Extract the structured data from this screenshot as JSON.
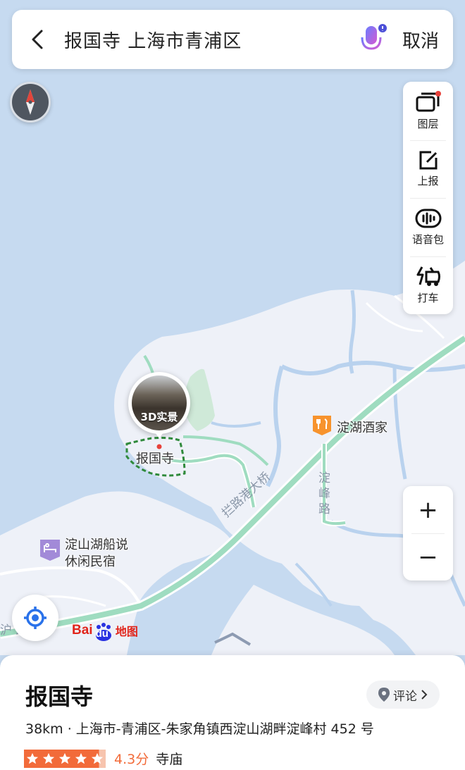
{
  "search": {
    "query": "报国寺 上海市青浦区",
    "cancel_label": "取消"
  },
  "tools": [
    {
      "label": "图层",
      "icon": "layers-icon"
    },
    {
      "label": "上报",
      "icon": "report-icon"
    },
    {
      "label": "语音包",
      "icon": "voice-pack-icon"
    },
    {
      "label": "打车",
      "icon": "taxi-icon"
    }
  ],
  "zoom": {
    "in_label": "+",
    "out_label": "−"
  },
  "map": {
    "pano_label": "3D实景",
    "poi_label": "报国寺",
    "restaurant_label": "淀湖酒家",
    "hotel_label_line1": "淀山湖船说",
    "hotel_label_line2": "休闲民宿",
    "bridge_label": "拦路港大桥",
    "road_label": "淀峰路",
    "edge_road_label": "沪 路"
  },
  "brand": {
    "part1": "Bai",
    "part2": "du",
    "part3": "地图"
  },
  "place": {
    "name": "报国寺",
    "review_label": "评论",
    "address": "38km · 上海市-青浦区-朱家角镇西淀山湖畔淀峰村 452 号",
    "rating_value": 4.3,
    "rating_label": "4.3分",
    "category": "寺庙",
    "stars_filled": 4.3
  },
  "colors": {
    "water": "#c6daf0",
    "land": "#eef1f8",
    "road_green": "#9fdcc0",
    "accent_orange": "#f26b3a",
    "mic_gradient_start": "#6a7cff",
    "mic_gradient_end": "#d45bd1"
  }
}
